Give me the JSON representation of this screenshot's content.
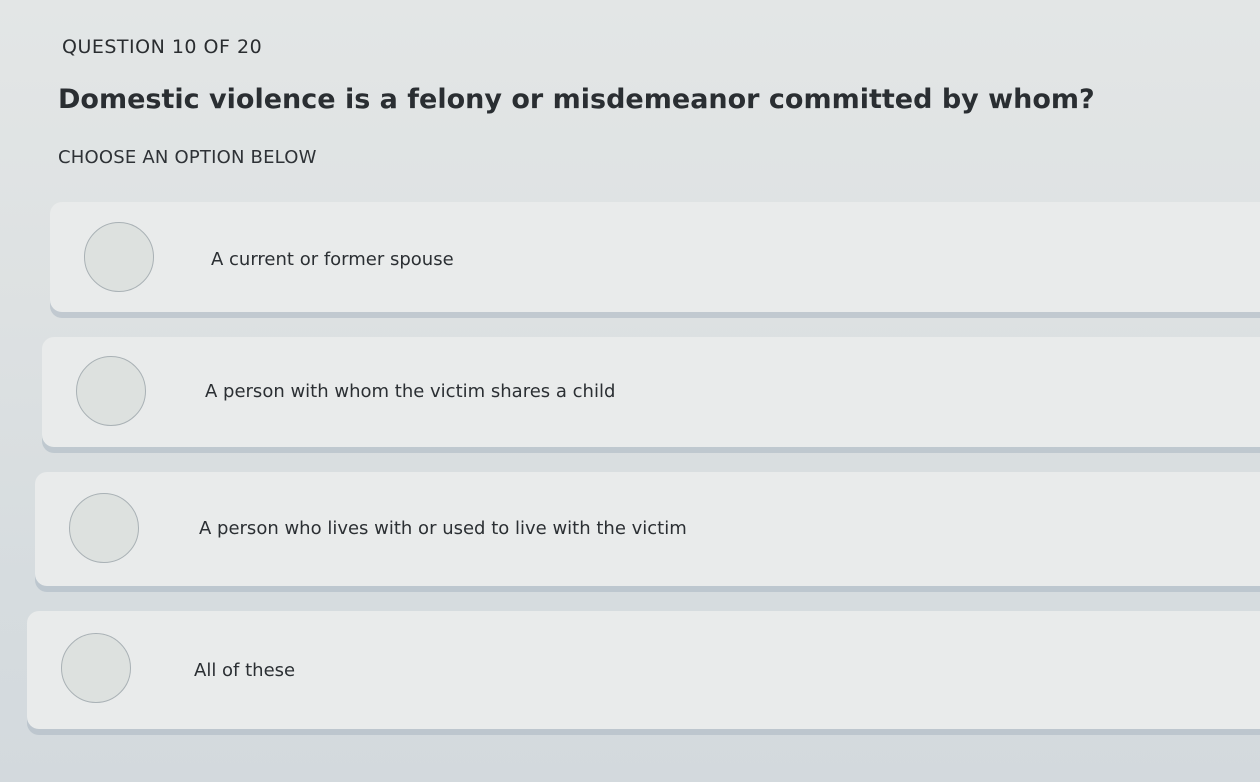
{
  "quiz": {
    "counter": "QUESTION 10 OF 20",
    "question": "Domestic violence is a felony or misdemeanor committed by whom?",
    "instruction": "CHOOSE AN OPTION BELOW",
    "options": [
      {
        "label": "A current or former spouse",
        "selected": false
      },
      {
        "label": "A person with whom the victim shares a child",
        "selected": false
      },
      {
        "label": "A person who lives with or used to live with the victim",
        "selected": false
      },
      {
        "label": "All of these",
        "selected": false
      }
    ]
  }
}
